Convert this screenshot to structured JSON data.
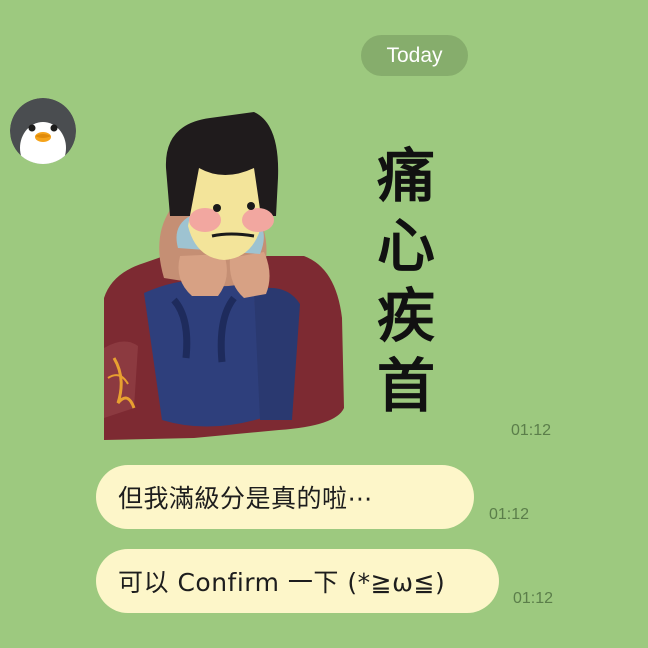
{
  "chat": {
    "date_divider": "Today",
    "contact_avatar": {
      "icon": "penguin-icon"
    },
    "sticker": {
      "caption": "痛心疾首",
      "caption_chars": [
        "痛",
        "心",
        "疾",
        "首"
      ],
      "description_icon": "person-covering-face-sticker"
    },
    "messages": [
      {
        "type": "sticker",
        "time": "01:12"
      },
      {
        "type": "text",
        "text": "但我滿級分是真的啦⋯",
        "time": "01:12"
      },
      {
        "type": "text",
        "text": "可以 Confirm 一下 (*≧ω≦)",
        "time": "01:12"
      }
    ]
  },
  "colors": {
    "background": "#9dc97f",
    "date_pill": "#86ad6c",
    "bubble": "#fdf6c9",
    "timestamp": "#5b7e4a"
  }
}
